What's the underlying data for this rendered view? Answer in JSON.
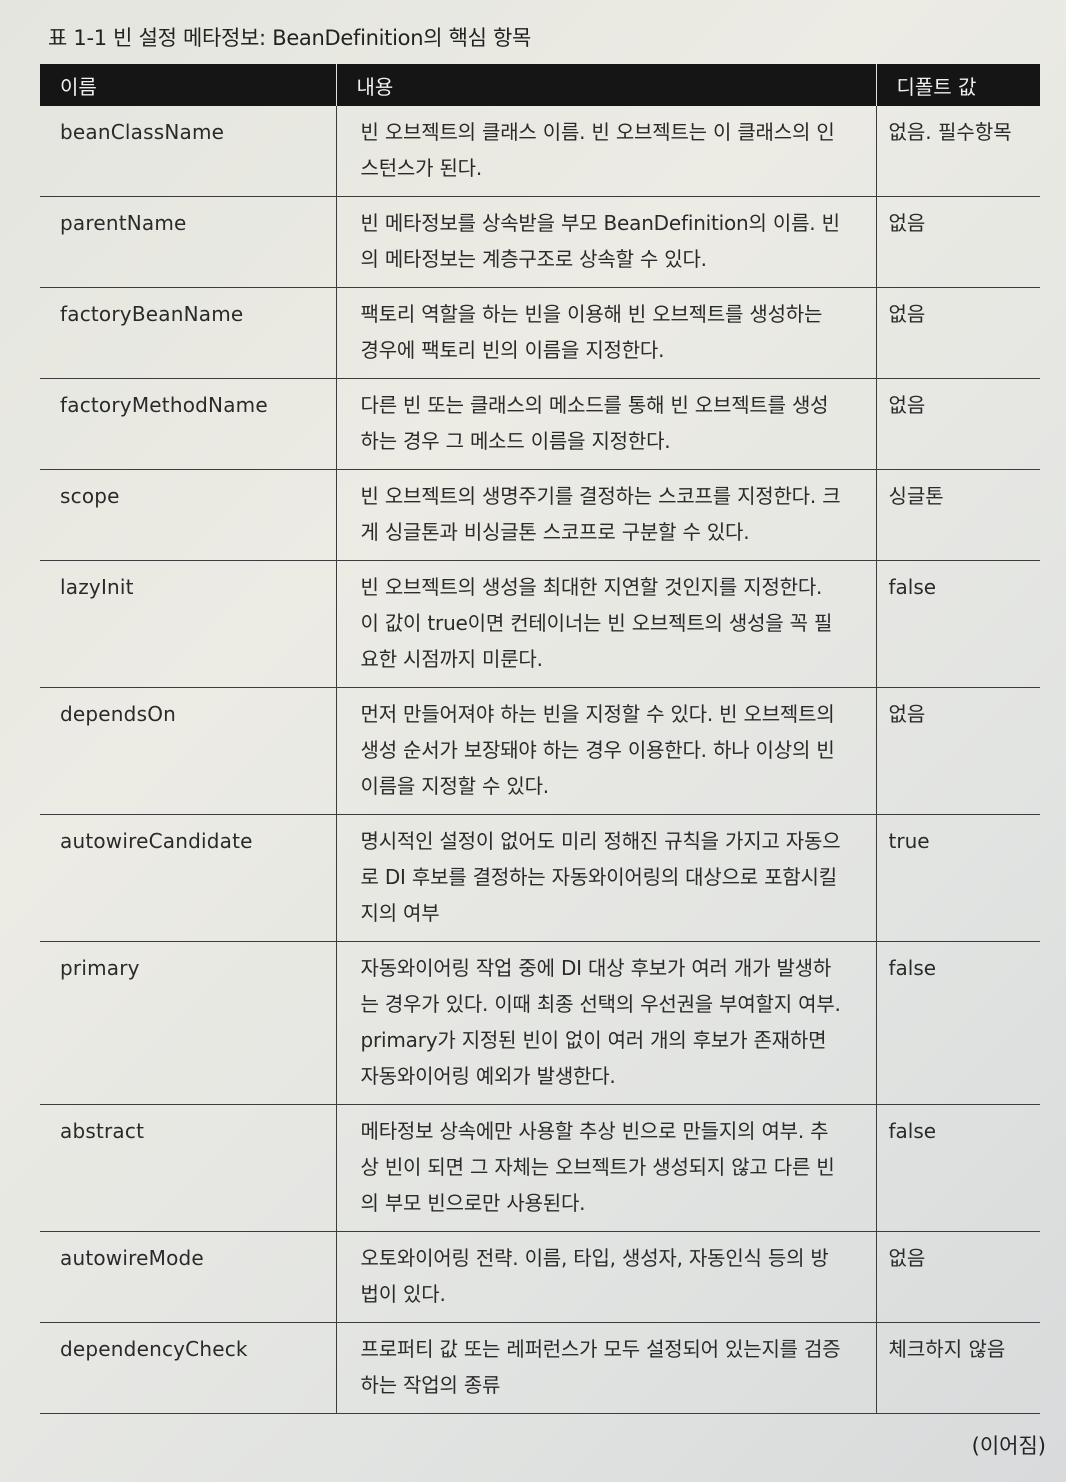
{
  "caption": "표 1-1 빈 설정 메타정보: BeanDefinition의 핵심 항목",
  "table": {
    "headers": [
      "이름",
      "내용",
      "디폴트 값"
    ],
    "rows": [
      {
        "name": "beanClassName",
        "desc": "빈 오브젝트의 클래스 이름. 빈 오브젝트는 이 클래스의 인스턴스가 된다.",
        "default": "없음. 필수항목"
      },
      {
        "name": "parentName",
        "desc": "빈 메타정보를 상속받을 부모 BeanDefinition의 이름. 빈의 메타정보는 계층구조로 상속할 수 있다.",
        "default": "없음"
      },
      {
        "name": "factoryBeanName",
        "desc": "팩토리 역할을 하는 빈을 이용해 빈 오브젝트를 생성하는 경우에 팩토리 빈의 이름을 지정한다.",
        "default": "없음"
      },
      {
        "name": "factoryMethodName",
        "desc": "다른 빈 또는 클래스의 메소드를 통해 빈 오브젝트를 생성하는 경우 그 메소드 이름을 지정한다.",
        "default": "없음"
      },
      {
        "name": "scope",
        "desc": "빈 오브젝트의 생명주기를 결정하는 스코프를 지정한다. 크게 싱글톤과 비싱글톤 스코프로 구분할 수 있다.",
        "default": "싱글톤"
      },
      {
        "name": "lazyInit",
        "desc": "빈 오브젝트의 생성을 최대한 지연할 것인지를 지정한다. 이 값이 true이면 컨테이너는 빈 오브젝트의 생성을 꼭 필요한 시점까지 미룬다.",
        "default": "false"
      },
      {
        "name": "dependsOn",
        "desc": "먼저 만들어져야 하는 빈을 지정할 수 있다. 빈 오브젝트의 생성 순서가 보장돼야 하는 경우 이용한다. 하나 이상의 빈 이름을 지정할 수 있다.",
        "default": "없음"
      },
      {
        "name": "autowireCandidate",
        "desc": "명시적인 설정이 없어도 미리 정해진 규칙을 가지고 자동으로 DI 후보를 결정하는 자동와이어링의 대상으로 포함시킬지의 여부",
        "default": "true"
      },
      {
        "name": "primary",
        "desc": "자동와이어링 작업 중에 DI 대상 후보가 여러 개가 발생하는 경우가 있다. 이때 최종 선택의 우선권을 부여할지 여부. primary가 지정된 빈이 없이 여러 개의 후보가 존재하면 자동와이어링 예외가 발생한다.",
        "default": "false"
      },
      {
        "name": "abstract",
        "desc": "메타정보 상속에만 사용할 추상 빈으로 만들지의 여부. 추상 빈이 되면 그 자체는 오브젝트가 생성되지 않고 다른 빈의 부모 빈으로만 사용된다.",
        "default": "false"
      },
      {
        "name": "autowireMode",
        "desc": "오토와이어링 전략. 이름, 타입, 생성자, 자동인식 등의 방법이 있다.",
        "default": "없음"
      },
      {
        "name": "dependencyCheck",
        "desc": "프로퍼티 값 또는 레퍼런스가 모두 설정되어 있는지를 검증하는 작업의 종류",
        "default": "체크하지 않음"
      }
    ]
  },
  "continued": "(이어짐)"
}
